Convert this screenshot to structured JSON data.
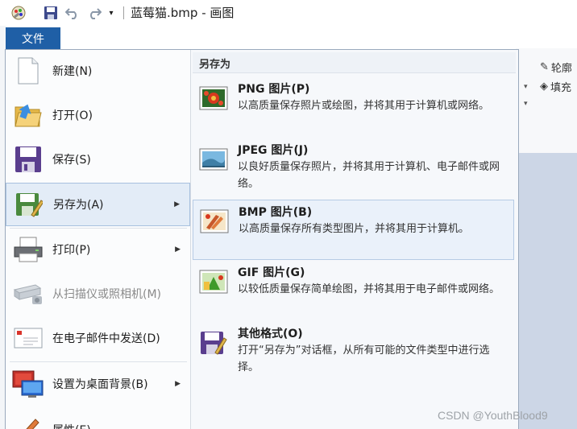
{
  "window": {
    "title": "蓝莓猫.bmp - 画图"
  },
  "file_tab": {
    "label": "文件"
  },
  "left_menu": [
    {
      "label": "新建(N)",
      "icon": "new-file-icon",
      "has_arrow": false,
      "disabled": false,
      "selected": false
    },
    {
      "label": "打开(O)",
      "icon": "open-folder-icon",
      "has_arrow": false,
      "disabled": false,
      "selected": false
    },
    {
      "label": "保存(S)",
      "icon": "save-disk-icon",
      "has_arrow": false,
      "disabled": false,
      "selected": false
    },
    {
      "label": "另存为(A)",
      "icon": "save-as-icon",
      "has_arrow": true,
      "disabled": false,
      "selected": true
    },
    {
      "label": "打印(P)",
      "icon": "printer-icon",
      "has_arrow": true,
      "disabled": false,
      "selected": false
    },
    {
      "label": "从扫描仪或照相机(M)",
      "icon": "scanner-icon",
      "has_arrow": false,
      "disabled": true,
      "selected": false
    },
    {
      "label": "在电子邮件中发送(D)",
      "icon": "email-icon",
      "has_arrow": false,
      "disabled": false,
      "selected": false
    },
    {
      "label": "设置为桌面背景(B)",
      "icon": "desktop-background-icon",
      "has_arrow": true,
      "disabled": false,
      "selected": false
    },
    {
      "label": "属性(E)",
      "icon": "properties-icon",
      "has_arrow": false,
      "disabled": false,
      "selected": false
    }
  ],
  "save_as_submenu": {
    "header": "另存为",
    "items": [
      {
        "title": "PNG 图片(P)",
        "description": "以高质量保存照片或绘图，并将其用于计算机或网络。",
        "icon": "png-image-icon",
        "selected": false
      },
      {
        "title": "JPEG 图片(J)",
        "description": "以良好质量保存照片，并将其用于计算机、电子邮件或网络。",
        "icon": "jpeg-image-icon",
        "selected": false
      },
      {
        "title": "BMP 图片(B)",
        "description": "以高质量保存所有类型图片，并将其用于计算机。",
        "icon": "bmp-image-icon",
        "selected": true
      },
      {
        "title": "GIF 图片(G)",
        "description": "以较低质量保存简单绘图，并将其用于电子邮件或网络。",
        "icon": "gif-image-icon",
        "selected": false
      },
      {
        "title": "其他格式(O)",
        "description": "打开“另存为”对话框，从所有可能的文件类型中进行选择。",
        "icon": "other-formats-icon",
        "selected": false
      }
    ]
  },
  "ribbon": {
    "outline_label": "轮廓",
    "fill_label": "填充"
  },
  "watermark": "CSDN @YouthBlood9",
  "colors": {
    "file_tab": "#1f5fa6",
    "selection_bg": "#e3ecf7",
    "selection_border": "#a7c0de",
    "menu_bg": "#f6f8fb"
  }
}
